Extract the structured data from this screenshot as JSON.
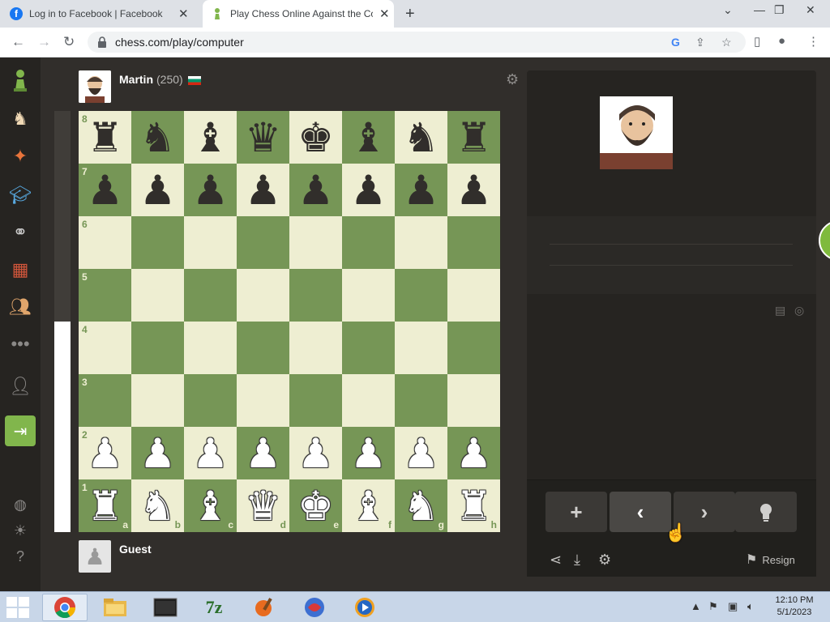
{
  "browser": {
    "tabs": [
      {
        "title": "Log in to Facebook | Facebook",
        "active": false
      },
      {
        "title": "Play Chess Online Against the Co",
        "active": true
      }
    ],
    "url": "chess.com/play/computer"
  },
  "players": {
    "top": {
      "name": "Martin",
      "rating": "(250)",
      "country": "Bulgaria"
    },
    "bottom": {
      "name": "Guest"
    }
  },
  "board": {
    "ranks": [
      "8",
      "7",
      "6",
      "5",
      "4",
      "3",
      "2",
      "1"
    ],
    "files": [
      "a",
      "b",
      "c",
      "d",
      "e",
      "f",
      "g",
      "h"
    ],
    "position": [
      [
        "♜",
        "♞",
        "♝",
        "♛",
        "♚",
        "♝",
        "♞",
        "♜"
      ],
      [
        "♟",
        "♟",
        "♟",
        "♟",
        "♟",
        "♟",
        "♟",
        "♟"
      ],
      [
        "",
        "",
        "",
        "",
        "",
        "",
        "",
        ""
      ],
      [
        "",
        "",
        "",
        "",
        "",
        "",
        "",
        ""
      ],
      [
        "",
        "",
        "",
        "",
        "",
        "",
        "",
        ""
      ],
      [
        "",
        "",
        "",
        "",
        "",
        "",
        "",
        ""
      ],
      [
        "♟",
        "♟",
        "♟",
        "♟",
        "♟",
        "♟",
        "♟",
        "♟"
      ],
      [
        "♜",
        "♞",
        "♝",
        "♛",
        "♚",
        "♝",
        "♞",
        "♜"
      ]
    ],
    "eval_white_fraction": 0.5
  },
  "controls": {
    "new_game": "+",
    "back": "‹",
    "forward": "›",
    "hint": "hint",
    "resign_label": "Resign"
  },
  "taskbar": {
    "time": "12:10 PM",
    "date": "5/1/2023"
  },
  "colors": {
    "board_light": "#eeeed2",
    "board_dark": "#769656",
    "accent_green": "#81b64c",
    "background": "#312e2b",
    "panel": "#262421"
  }
}
